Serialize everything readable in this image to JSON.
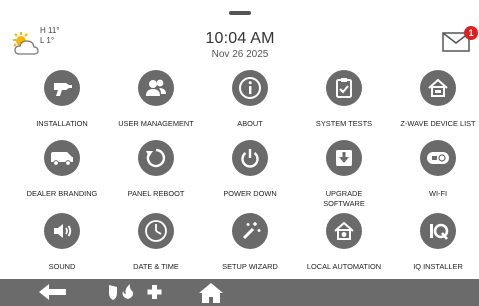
{
  "weather": {
    "high": "H 11°",
    "low": "L 1°",
    "icon": "partly-sunny-icon"
  },
  "clock": {
    "time": "10:04 AM",
    "date": "Nov 26 2025"
  },
  "mail": {
    "unread_count": "1",
    "icon": "envelope-icon"
  },
  "tiles": [
    {
      "label": "INSTALLATION",
      "icon": "drill-icon"
    },
    {
      "label": "USER MANAGEMENT",
      "icon": "users-icon"
    },
    {
      "label": "ABOUT",
      "icon": "info-icon"
    },
    {
      "label": "SYSTEM TESTS",
      "icon": "clipboard-check-icon"
    },
    {
      "label": "Z-WAVE DEVICE LIST",
      "icon": "home-device-icon"
    },
    {
      "label": "DEALER BRANDING",
      "icon": "van-icon"
    },
    {
      "label": "PANEL REBOOT",
      "icon": "reboot-icon"
    },
    {
      "label": "POWER DOWN",
      "icon": "power-icon"
    },
    {
      "label": "UPGRADE\nSOFTWARE",
      "icon": "download-icon"
    },
    {
      "label": "WI-FI",
      "icon": "wifi-router-icon"
    },
    {
      "label": "SOUND",
      "icon": "speaker-icon"
    },
    {
      "label": "DATE & TIME",
      "icon": "clock-icon"
    },
    {
      "label": "SETUP WIZARD",
      "icon": "magic-wand-icon"
    },
    {
      "label": "LOCAL AUTOMATION",
      "icon": "home-gear-icon"
    },
    {
      "label": "IQ INSTALLER",
      "icon": "iq-installer-icon"
    }
  ],
  "bottombar": {
    "back_icon": "back-arrow-icon",
    "emergency_icon": "emergency-icon",
    "home_icon": "home-icon"
  },
  "colors": {
    "tile_circle": "#6a6a6a",
    "bottom_bar": "#6b6b6b",
    "badge": "#e02020",
    "sun": "#f5b800"
  }
}
